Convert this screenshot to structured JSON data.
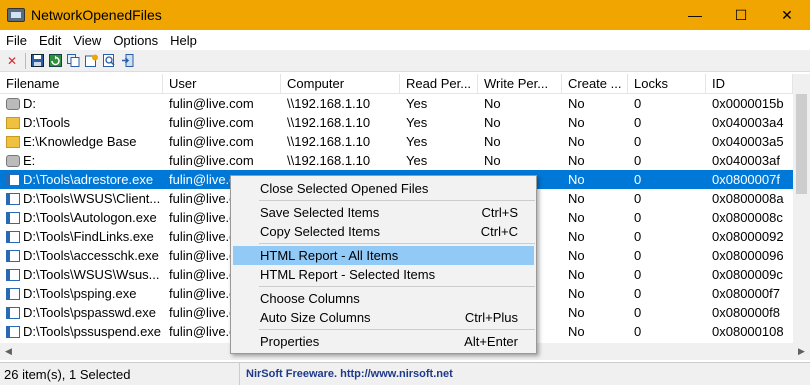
{
  "window": {
    "title": "NetworkOpenedFiles",
    "minimize_glyph": "—",
    "maximize_glyph": "☐",
    "close_glyph": "✕"
  },
  "menu": [
    "File",
    "Edit",
    "View",
    "Options",
    "Help"
  ],
  "toolbar": {
    "icons": [
      "close-x-icon",
      "save-icon",
      "refresh-icon",
      "copy-icon",
      "html-report-icon",
      "find-icon",
      "exit-icon"
    ]
  },
  "columns": [
    "Filename",
    "User",
    "Computer",
    "Read Per...",
    "Write Per...",
    "Create ...",
    "Locks",
    "ID"
  ],
  "rows": [
    {
      "icon": "drive",
      "filename": "D:",
      "user": "fulin@live.com",
      "computer": "\\\\192.168.1.10",
      "read": "Yes",
      "write": "No",
      "create": "No",
      "locks": "0",
      "id": "0x0000015b"
    },
    {
      "icon": "folder",
      "filename": "D:\\Tools",
      "user": "fulin@live.com",
      "computer": "\\\\192.168.1.10",
      "read": "Yes",
      "write": "No",
      "create": "No",
      "locks": "0",
      "id": "0x040003a4"
    },
    {
      "icon": "folder",
      "filename": "E:\\Knowledge Base",
      "user": "fulin@live.com",
      "computer": "\\\\192.168.1.10",
      "read": "Yes",
      "write": "No",
      "create": "No",
      "locks": "0",
      "id": "0x040003a5"
    },
    {
      "icon": "drive",
      "filename": "E:",
      "user": "fulin@live.com",
      "computer": "\\\\192.168.1.10",
      "read": "Yes",
      "write": "No",
      "create": "No",
      "locks": "0",
      "id": "0x040003af"
    },
    {
      "icon": "file",
      "filename": "D:\\Tools\\adrestore.exe",
      "user": "fulin@live.c",
      "computer": "",
      "read": "",
      "write": "",
      "create": "No",
      "locks": "0",
      "id": "0x0800007f",
      "selected": true
    },
    {
      "icon": "file",
      "filename": "D:\\Tools\\WSUS\\Client...",
      "user": "fulin@live.c",
      "computer": "",
      "read": "",
      "write": "",
      "create": "No",
      "locks": "0",
      "id": "0x0800008a"
    },
    {
      "icon": "file",
      "filename": "D:\\Tools\\Autologon.exe",
      "user": "fulin@live.c",
      "computer": "",
      "read": "",
      "write": "",
      "create": "No",
      "locks": "0",
      "id": "0x0800008c"
    },
    {
      "icon": "file",
      "filename": "D:\\Tools\\FindLinks.exe",
      "user": "fulin@live.c",
      "computer": "",
      "read": "",
      "write": "",
      "create": "No",
      "locks": "0",
      "id": "0x08000092"
    },
    {
      "icon": "file",
      "filename": "D:\\Tools\\accesschk.exe",
      "user": "fulin@live.c",
      "computer": "",
      "read": "",
      "write": "",
      "create": "No",
      "locks": "0",
      "id": "0x08000096"
    },
    {
      "icon": "file",
      "filename": "D:\\Tools\\WSUS\\Wsus...",
      "user": "fulin@live.c",
      "computer": "",
      "read": "",
      "write": "",
      "create": "No",
      "locks": "0",
      "id": "0x0800009c"
    },
    {
      "icon": "file",
      "filename": "D:\\Tools\\psping.exe",
      "user": "fulin@live.c",
      "computer": "",
      "read": "",
      "write": "",
      "create": "No",
      "locks": "0",
      "id": "0x080000f7"
    },
    {
      "icon": "file",
      "filename": "D:\\Tools\\pspasswd.exe",
      "user": "fulin@live.c",
      "computer": "",
      "read": "",
      "write": "",
      "create": "No",
      "locks": "0",
      "id": "0x080000f8"
    },
    {
      "icon": "file",
      "filename": "D:\\Tools\\pssuspend.exe",
      "user": "fulin@live.c",
      "computer": "",
      "read": "",
      "write": "",
      "create": "No",
      "locks": "0",
      "id": "0x08000108"
    }
  ],
  "context_menu": [
    {
      "label": "Close Selected Opened Files",
      "shortcut": ""
    },
    {
      "separator": true
    },
    {
      "label": "Save Selected Items",
      "shortcut": "Ctrl+S"
    },
    {
      "label": "Copy Selected Items",
      "shortcut": "Ctrl+C"
    },
    {
      "separator": true
    },
    {
      "label": "HTML Report - All Items",
      "shortcut": "",
      "highlighted": true
    },
    {
      "label": "HTML Report - Selected Items",
      "shortcut": ""
    },
    {
      "separator": true
    },
    {
      "label": "Choose Columns",
      "shortcut": ""
    },
    {
      "label": "Auto Size Columns",
      "shortcut": "Ctrl+Plus"
    },
    {
      "separator": true
    },
    {
      "label": "Properties",
      "shortcut": "Alt+Enter"
    }
  ],
  "status": {
    "count": "26 item(s), 1 Selected",
    "brand": "NirSoft Freeware.  http://www.nirsoft.net"
  }
}
